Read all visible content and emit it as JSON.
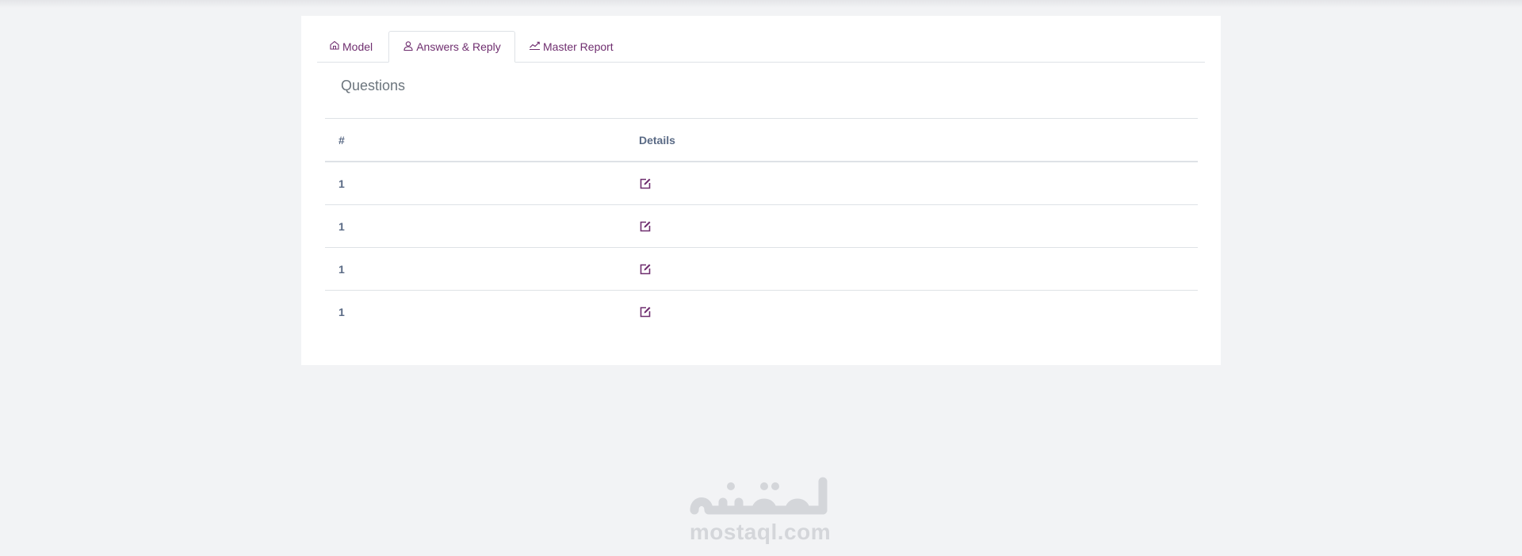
{
  "tabs": [
    {
      "label": "Model",
      "icon": "home-icon",
      "active": false
    },
    {
      "label": "Answers & Reply",
      "icon": "user-icon",
      "active": true
    },
    {
      "label": "Master Report",
      "icon": "chart-line-icon",
      "active": false
    }
  ],
  "section": {
    "title": "Questions"
  },
  "table": {
    "headers": [
      "#",
      "Details"
    ],
    "rows": [
      {
        "num": "1",
        "details_icon": "edit-icon"
      },
      {
        "num": "1",
        "details_icon": "edit-icon"
      },
      {
        "num": "1",
        "details_icon": "edit-icon"
      },
      {
        "num": "1",
        "details_icon": "edit-icon"
      }
    ]
  },
  "watermark": {
    "arabic": "مستقل",
    "text": "mostaql.com"
  },
  "colors": {
    "accent": "#6f2e6f",
    "text_muted": "#6c757d",
    "page_bg": "#f2f3f5",
    "card_bg": "#ffffff",
    "border": "#dee2e6"
  }
}
